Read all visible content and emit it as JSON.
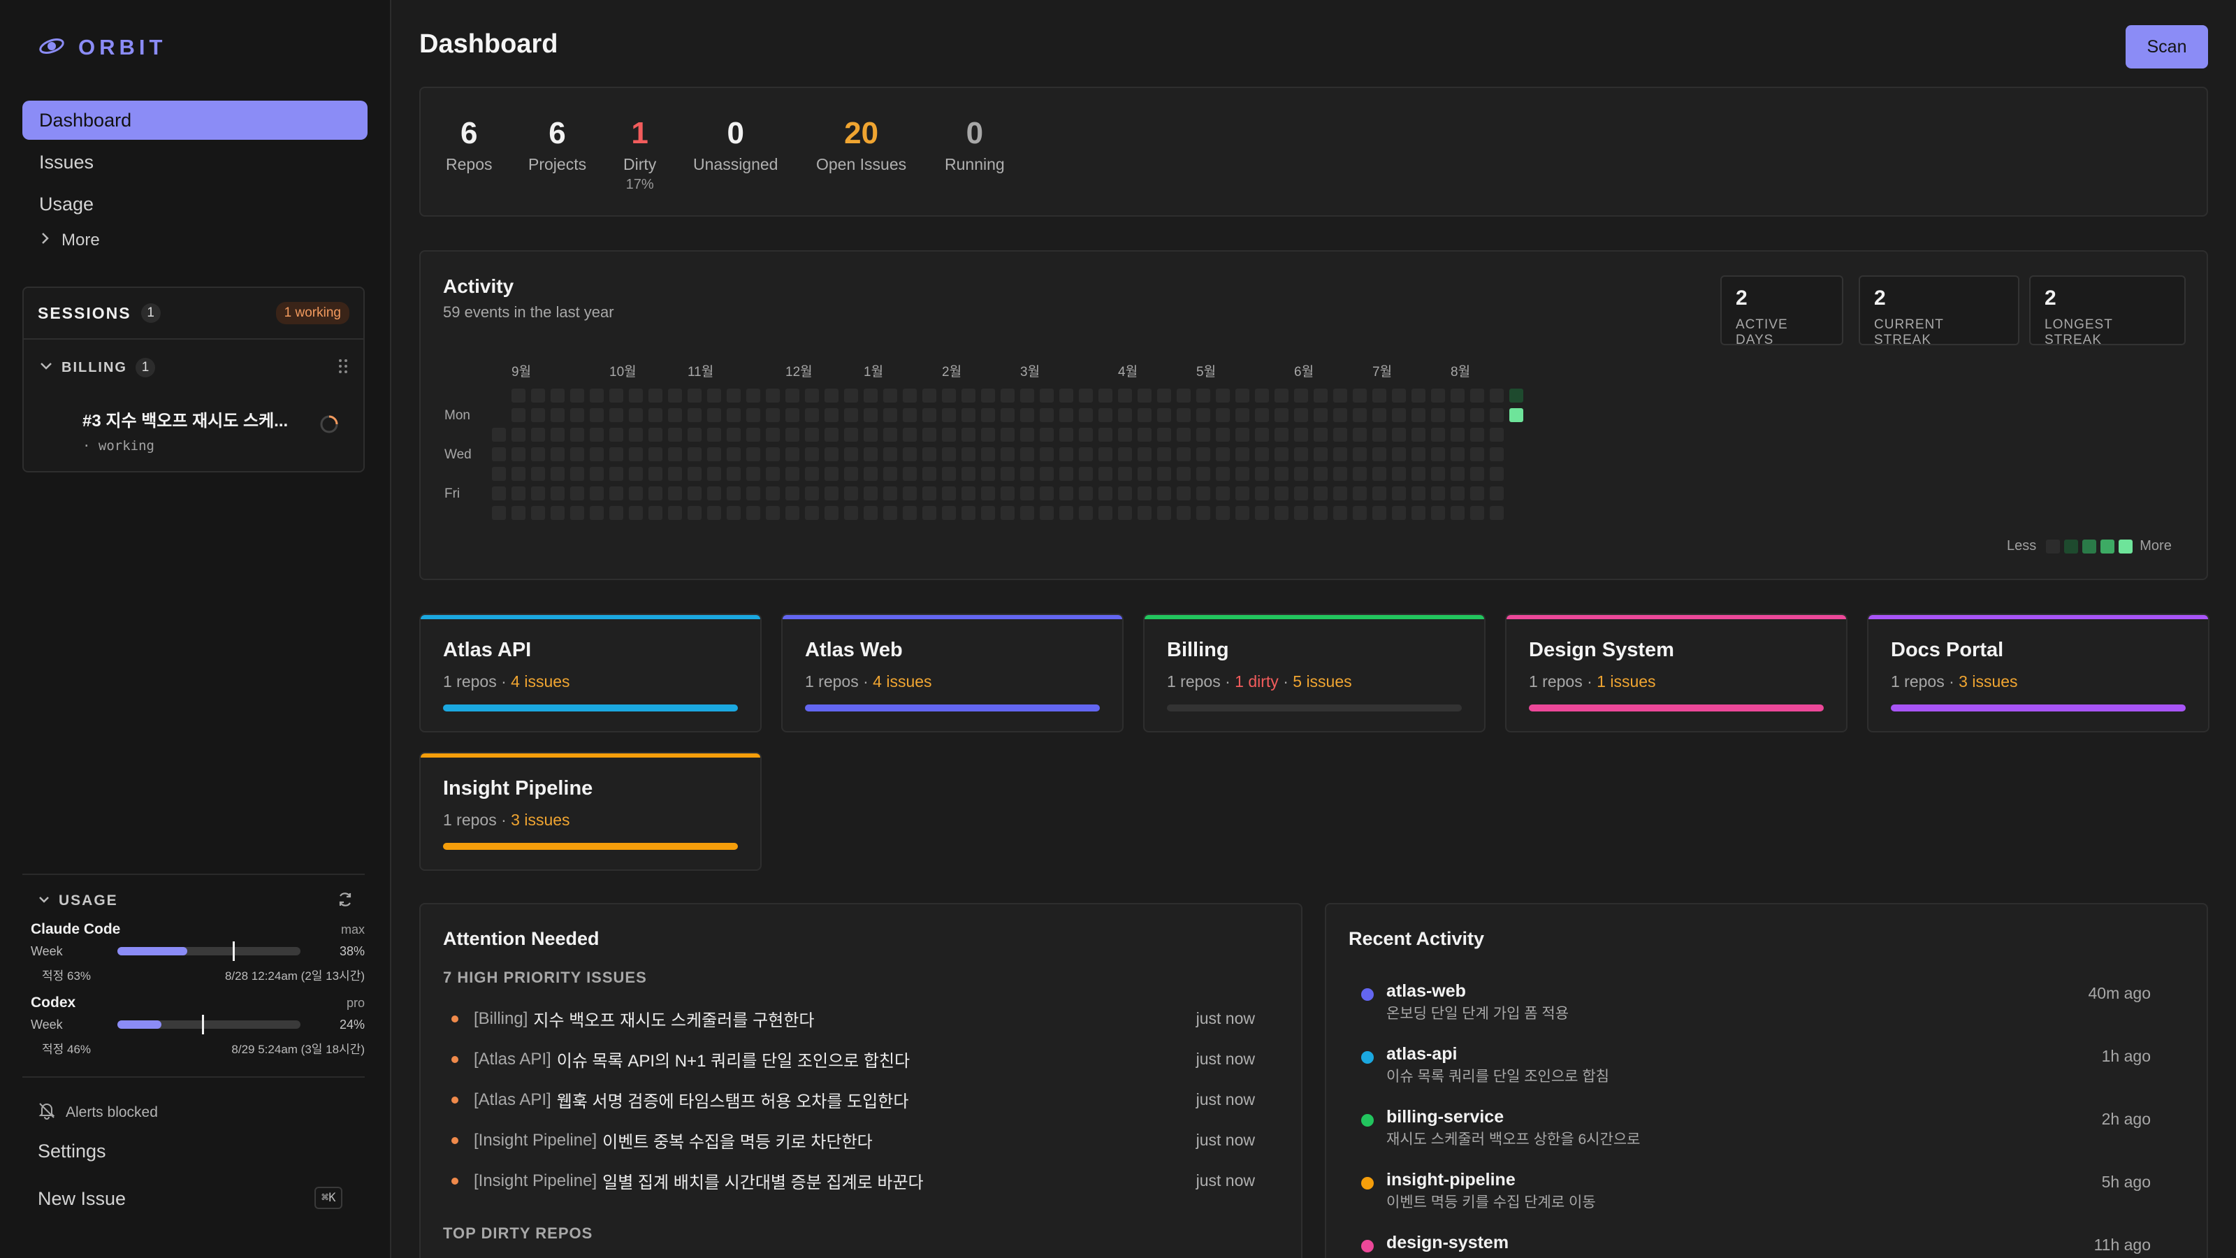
{
  "app": {
    "name": "ORBIT"
  },
  "nav": {
    "items": [
      "Dashboard",
      "Issues",
      "Usage"
    ],
    "more": "More"
  },
  "sessions": {
    "title": "SESSIONS",
    "count": "1",
    "working_badge": "1 working",
    "group": {
      "name": "BILLING",
      "count": "1"
    },
    "item": {
      "title": "#3 지수 백오프 재시도 스케...",
      "status": "· working"
    }
  },
  "usage": {
    "title": "USAGE",
    "tools": [
      {
        "name": "Claude Code",
        "plan": "max",
        "period": "Week",
        "percent_text": "38%",
        "percent": 38,
        "pace": 63,
        "pace_text": "적정 63%",
        "reset": "8/28 12:24am (2일 13시간)"
      },
      {
        "name": "Codex",
        "plan": "pro",
        "period": "Week",
        "percent_text": "24%",
        "percent": 24,
        "pace": 46,
        "pace_text": "적정 46%",
        "reset": "8/29 5:24am (3일 18시간)"
      }
    ]
  },
  "footer": {
    "alerts": "Alerts blocked",
    "settings": "Settings",
    "new_issue": "New Issue",
    "shortcut": "⌘K"
  },
  "header": {
    "title": "Dashboard",
    "scan": "Scan"
  },
  "stats": [
    {
      "value": "6",
      "label": "Repos",
      "sub": "",
      "color": "#f2f2f2"
    },
    {
      "value": "6",
      "label": "Projects",
      "sub": "",
      "color": "#f2f2f2"
    },
    {
      "value": "1",
      "label": "Dirty",
      "sub": "17%",
      "color": "#f25c5c"
    },
    {
      "value": "0",
      "label": "Unassigned",
      "sub": "",
      "color": "#f2f2f2"
    },
    {
      "value": "20",
      "label": "Open Issues",
      "sub": "",
      "color": "#f0a531"
    },
    {
      "value": "0",
      "label": "Running",
      "sub": "",
      "color": "#a8a8a8"
    }
  ],
  "activity": {
    "title": "Activity",
    "subtitle": "59 events in the last year",
    "streaks": [
      {
        "value": "2",
        "label": "ACTIVE DAYS"
      },
      {
        "value": "2",
        "label": "CURRENT STREAK"
      },
      {
        "value": "2",
        "label": "LONGEST STREAK"
      }
    ],
    "months": [
      "9월",
      "10월",
      "11월",
      "12월",
      "1월",
      "2월",
      "3월",
      "4월",
      "5월",
      "6월",
      "7월",
      "8월"
    ],
    "days": [
      "Mon",
      "Wed",
      "Fri"
    ],
    "legend": {
      "less": "Less",
      "more": "More"
    }
  },
  "projects": [
    {
      "name": "Atlas API",
      "repos": "1 repos",
      "dirty": "",
      "issues": "4 issues",
      "color": "#1ba8e0"
    },
    {
      "name": "Atlas Web",
      "repos": "1 repos",
      "dirty": "",
      "issues": "4 issues",
      "color": "#6366f1"
    },
    {
      "name": "Billing",
      "repos": "1 repos",
      "dirty": "1 dirty",
      "issues": "5 issues",
      "color": "#22c55e"
    },
    {
      "name": "Design System",
      "repos": "1 repos",
      "dirty": "",
      "issues": "1 issues",
      "color": "#ec4899"
    },
    {
      "name": "Docs Portal",
      "repos": "1 repos",
      "dirty": "",
      "issues": "3 issues",
      "color": "#a855f7"
    },
    {
      "name": "Insight Pipeline",
      "repos": "1 repos",
      "dirty": "",
      "issues": "3 issues",
      "color": "#f59e0b"
    }
  ],
  "attention": {
    "title": "Attention Needed",
    "subtitle": "7 HIGH PRIORITY ISSUES",
    "issues": [
      {
        "project": "[Billing]",
        "title": "지수 백오프 재시도 스케줄러를 구현한다",
        "time": "just now"
      },
      {
        "project": "[Atlas API]",
        "title": "이슈 목록 API의 N+1 쿼리를 단일 조인으로 합친다",
        "time": "just now"
      },
      {
        "project": "[Atlas API]",
        "title": "웹훅 서명 검증에 타임스탬프 허용 오차를 도입한다",
        "time": "just now"
      },
      {
        "project": "[Insight Pipeline]",
        "title": "이벤트 중복 수집을 멱등 키로 차단한다",
        "time": "just now"
      },
      {
        "project": "[Insight Pipeline]",
        "title": "일별 집계 배치를 시간대별 증분 집계로 바꾼다",
        "time": "just now"
      }
    ],
    "dirty_title": "TOP DIRTY REPOS"
  },
  "recent": {
    "title": "Recent Activity",
    "items": [
      {
        "name": "atlas-web",
        "desc": "온보딩 단일 단계 가입 폼 적용",
        "time": "40m ago",
        "color": "#6366f1"
      },
      {
        "name": "atlas-api",
        "desc": "이슈 목록 쿼리를 단일 조인으로 합침",
        "time": "1h ago",
        "color": "#1ba8e0"
      },
      {
        "name": "billing-service",
        "desc": "재시도 스케줄러 백오프 상한을 6시간으로",
        "time": "2h ago",
        "color": "#22c55e"
      },
      {
        "name": "insight-pipeline",
        "desc": "이벤트 멱등 키를 수집 단계로 이동",
        "time": "5h ago",
        "color": "#f59e0b"
      },
      {
        "name": "design-system",
        "desc": "",
        "time": "11h ago",
        "color": "#ec4899"
      }
    ]
  }
}
